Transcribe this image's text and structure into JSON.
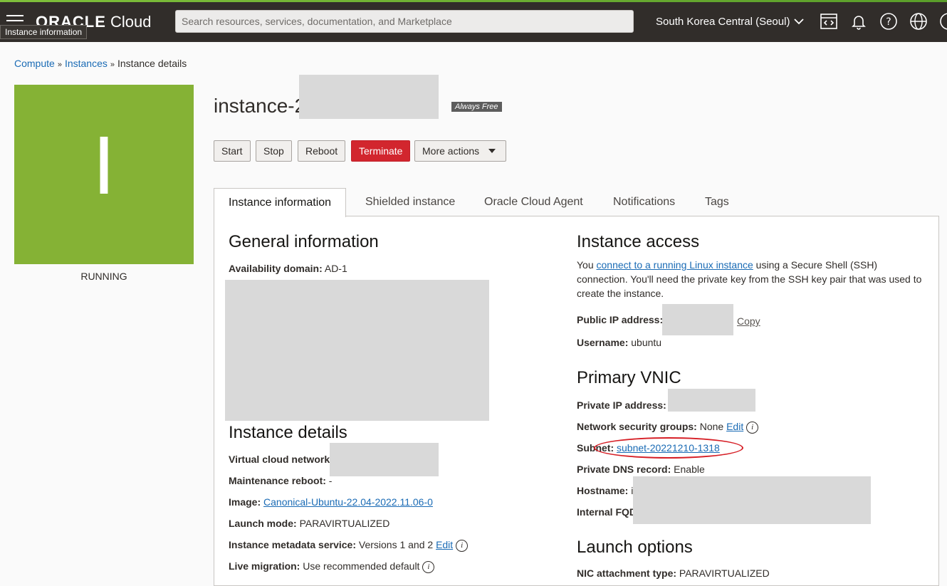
{
  "header": {
    "logo_bold": "ORACLE",
    "logo_light": "Cloud",
    "tooltip": "Instance information",
    "search_placeholder": "Search resources, services, documentation, and Marketplace",
    "region": "South Korea Central (Seoul)"
  },
  "breadcrumb": {
    "items": [
      "Compute",
      "Instances",
      "Instance details"
    ],
    "separator": "»"
  },
  "instance": {
    "letter": "I",
    "state": "RUNNING",
    "name_prefix": "instance-2",
    "badge": "Always Free",
    "avatar_color": "#85b235"
  },
  "actions": {
    "start": "Start",
    "stop": "Stop",
    "reboot": "Reboot",
    "terminate": "Terminate",
    "more": "More actions"
  },
  "tabs": [
    "Instance information",
    "Shielded instance",
    "Oracle Cloud Agent",
    "Notifications",
    "Tags"
  ],
  "general": {
    "heading": "General information",
    "availability_label": "Availability domain:",
    "availability_value": "AD-1"
  },
  "details": {
    "heading": "Instance details",
    "vcn_label": "Virtual cloud network",
    "maintenance_label": "Maintenance reboot:",
    "maintenance_value": "-",
    "image_label": "Image:",
    "image_value": "Canonical-Ubuntu-22.04-2022.11.06-0",
    "launch_label": "Launch mode:",
    "launch_value": "PARAVIRTUALIZED",
    "metadata_label": "Instance metadata service:",
    "metadata_value": "Versions 1 and 2",
    "metadata_edit": "Edit",
    "migration_label": "Live migration:",
    "migration_value": "Use recommended default"
  },
  "access": {
    "heading": "Instance access",
    "text_before": "You",
    "link": "connect to a running Linux instance",
    "text_after": "using a Secure Shell (SSH) connection. You'll need the private key from the SSH key pair that was used to create the instance.",
    "public_ip_label": "Public IP address:",
    "copy": "Copy",
    "username_label": "Username:",
    "username_value": "ubuntu"
  },
  "vnic": {
    "heading": "Primary VNIC",
    "private_ip_label": "Private IP address:",
    "nsg_label": "Network security groups:",
    "nsg_value": "None",
    "nsg_edit": "Edit",
    "subnet_label": "Subnet:",
    "subnet_value": "subnet-20221210-1318",
    "dns_label": "Private DNS record:",
    "dns_value": "Enable",
    "hostname_label": "Hostname:",
    "hostname_value": "i",
    "fqdn_label": "Internal FQD"
  },
  "launch": {
    "heading": "Launch options",
    "nic_label": "NIC attachment type:",
    "nic_value": "PARAVIRTUALIZED"
  }
}
